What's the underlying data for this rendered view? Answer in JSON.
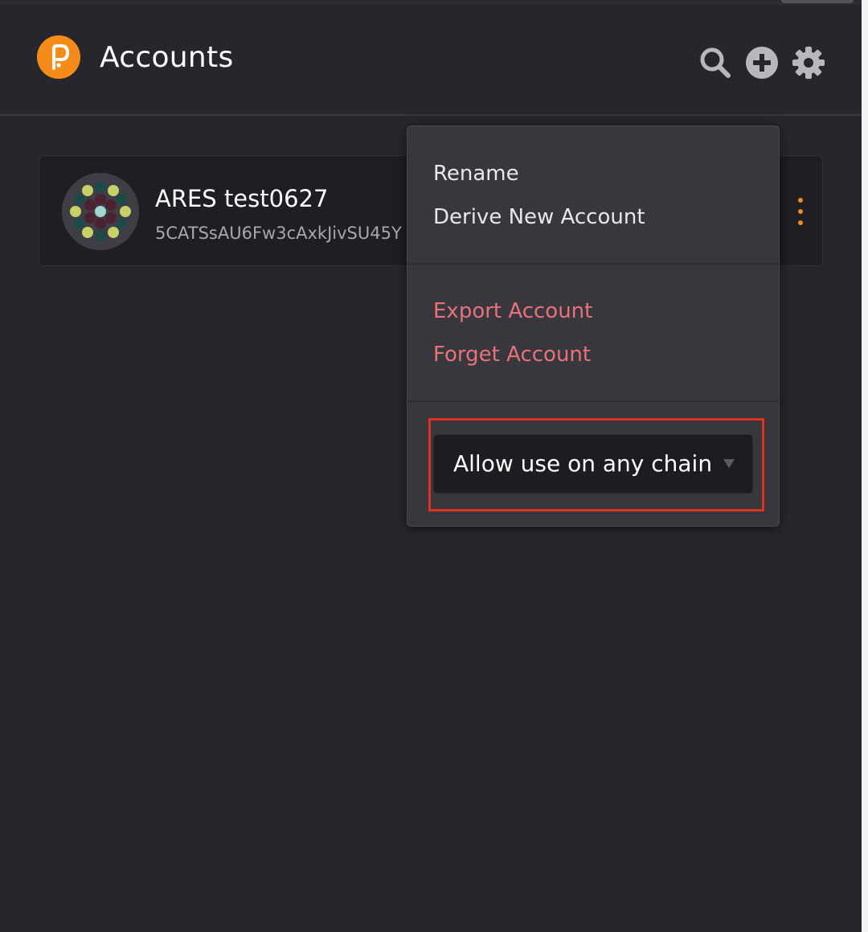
{
  "header": {
    "title": "Accounts",
    "logo_icon": "polkadot-logo",
    "actions": [
      {
        "icon": "search-icon"
      },
      {
        "icon": "add-circle-icon"
      },
      {
        "icon": "gear-icon"
      }
    ]
  },
  "account": {
    "name": "ARES test0627",
    "address": "5CATSsAU6Fw3cAxkJivSU45Y",
    "avatar_icon": "identicon",
    "menu_icon": "kebab-vertical-icon"
  },
  "menu": {
    "items_group1": [
      {
        "label": "Rename"
      },
      {
        "label": "Derive New Account"
      }
    ],
    "items_group2": [
      {
        "label": "Export Account"
      },
      {
        "label": "Forget Account"
      }
    ],
    "chain_select": {
      "value": "Allow use on any chain"
    }
  },
  "colors": {
    "background": "#27262c",
    "accent": "#f58c1a",
    "danger_text": "#e8727a",
    "highlight_border": "#e0321f"
  }
}
